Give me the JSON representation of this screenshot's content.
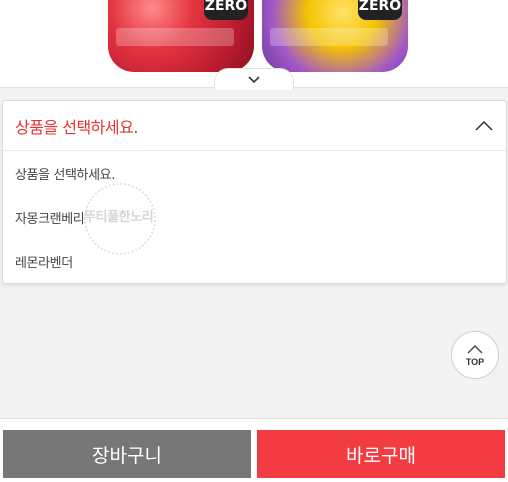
{
  "product_images": {
    "left_badge": "ZERO",
    "right_badge": "ZERO"
  },
  "dropdown": {
    "header_label": "상품을 선택하세요.",
    "options": [
      "상품을 선택하세요.",
      "자몽크랜베리",
      "레몬라벤더"
    ]
  },
  "watermark": {
    "text": "뚜티풀한노리"
  },
  "top_button": {
    "label": "TOP"
  },
  "bottom_bar": {
    "cart_label": "장바구니",
    "buy_label": "바로구매"
  },
  "icons": {
    "toggle": "chevron-down-icon",
    "dropdown": "chevron-up-icon",
    "top": "arrow-up-icon"
  },
  "colors": {
    "accent_red": "#e5342f",
    "buy_button": "#f23c42",
    "cart_button": "#777777"
  }
}
